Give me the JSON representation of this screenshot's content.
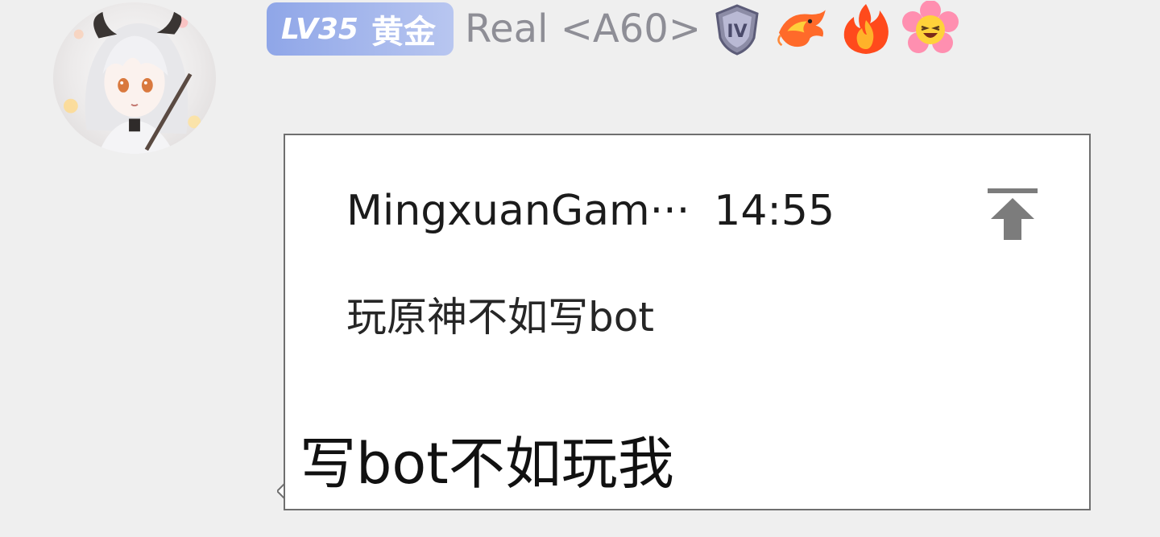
{
  "sender": {
    "avatar_icon": "anime-girl-avatar",
    "level_badge": {
      "level": "LV35",
      "rank": "黄金",
      "color": "#9fb4ec"
    },
    "nickname": "Real <A60>",
    "badges": [
      {
        "icon": "shield-rank-iv-icon",
        "label": "IV"
      },
      {
        "icon": "dragon-icon"
      },
      {
        "icon": "fire-icon"
      },
      {
        "icon": "laughing-flower-icon"
      }
    ]
  },
  "message": {
    "quote": {
      "author": "MingxuanGam···",
      "time": "14:55",
      "text": "玩原神不如写bot",
      "jump_icon": "jump-to-original-icon"
    },
    "text": "写bot不如玩我"
  }
}
